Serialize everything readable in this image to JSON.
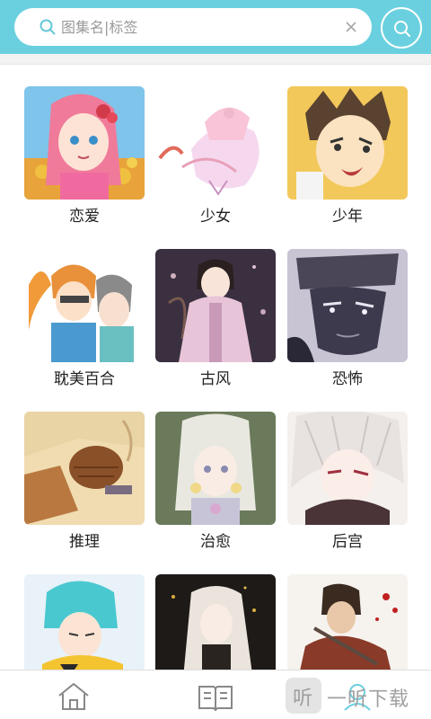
{
  "search": {
    "placeholder": "图集名|标签"
  },
  "categories": [
    {
      "label": "恋爱",
      "art": "romance"
    },
    {
      "label": "少女",
      "art": "shoujo"
    },
    {
      "label": "少年",
      "art": "shounen"
    },
    {
      "label": "耽美百合",
      "art": "bl-gl"
    },
    {
      "label": "古风",
      "art": "ancient"
    },
    {
      "label": "恐怖",
      "art": "horror"
    },
    {
      "label": "推理",
      "art": "mystery"
    },
    {
      "label": "治愈",
      "art": "healing"
    },
    {
      "label": "后宫",
      "art": "harem"
    },
    {
      "label": "",
      "art": "blue-hair"
    },
    {
      "label": "",
      "art": "white-hair"
    },
    {
      "label": "",
      "art": "warrior"
    }
  ],
  "bottom_nav": {
    "items": [
      "home-icon",
      "book-icon",
      "user-icon"
    ]
  },
  "watermark": {
    "char": "听",
    "text": "一听下载"
  },
  "colors": {
    "header": "#6ad0df",
    "background": "#ffffff"
  }
}
